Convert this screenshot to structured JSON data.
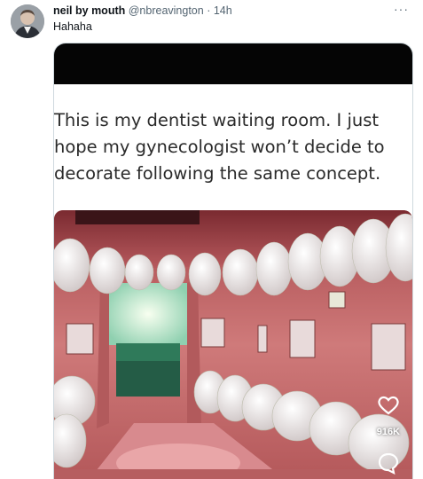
{
  "tweet": {
    "author_name": "neil by mouth",
    "handle": "@nbreavington",
    "separator": "·",
    "time": "14h",
    "more": "···",
    "text": "Hahaha"
  },
  "media": {
    "caption_lines": [
      "This is my dentist waiting room. I just",
      "hope my gynecologist won’t decide to",
      "decorate following the same concept."
    ],
    "view_count": "916K"
  },
  "icons": {
    "like": "heart-outline-icon",
    "reply": "speech-bubble-icon",
    "more": "more-horizontal-icon"
  },
  "colors": {
    "text": "#0f1419",
    "muted": "#536471",
    "room_pink": "#c97676"
  }
}
